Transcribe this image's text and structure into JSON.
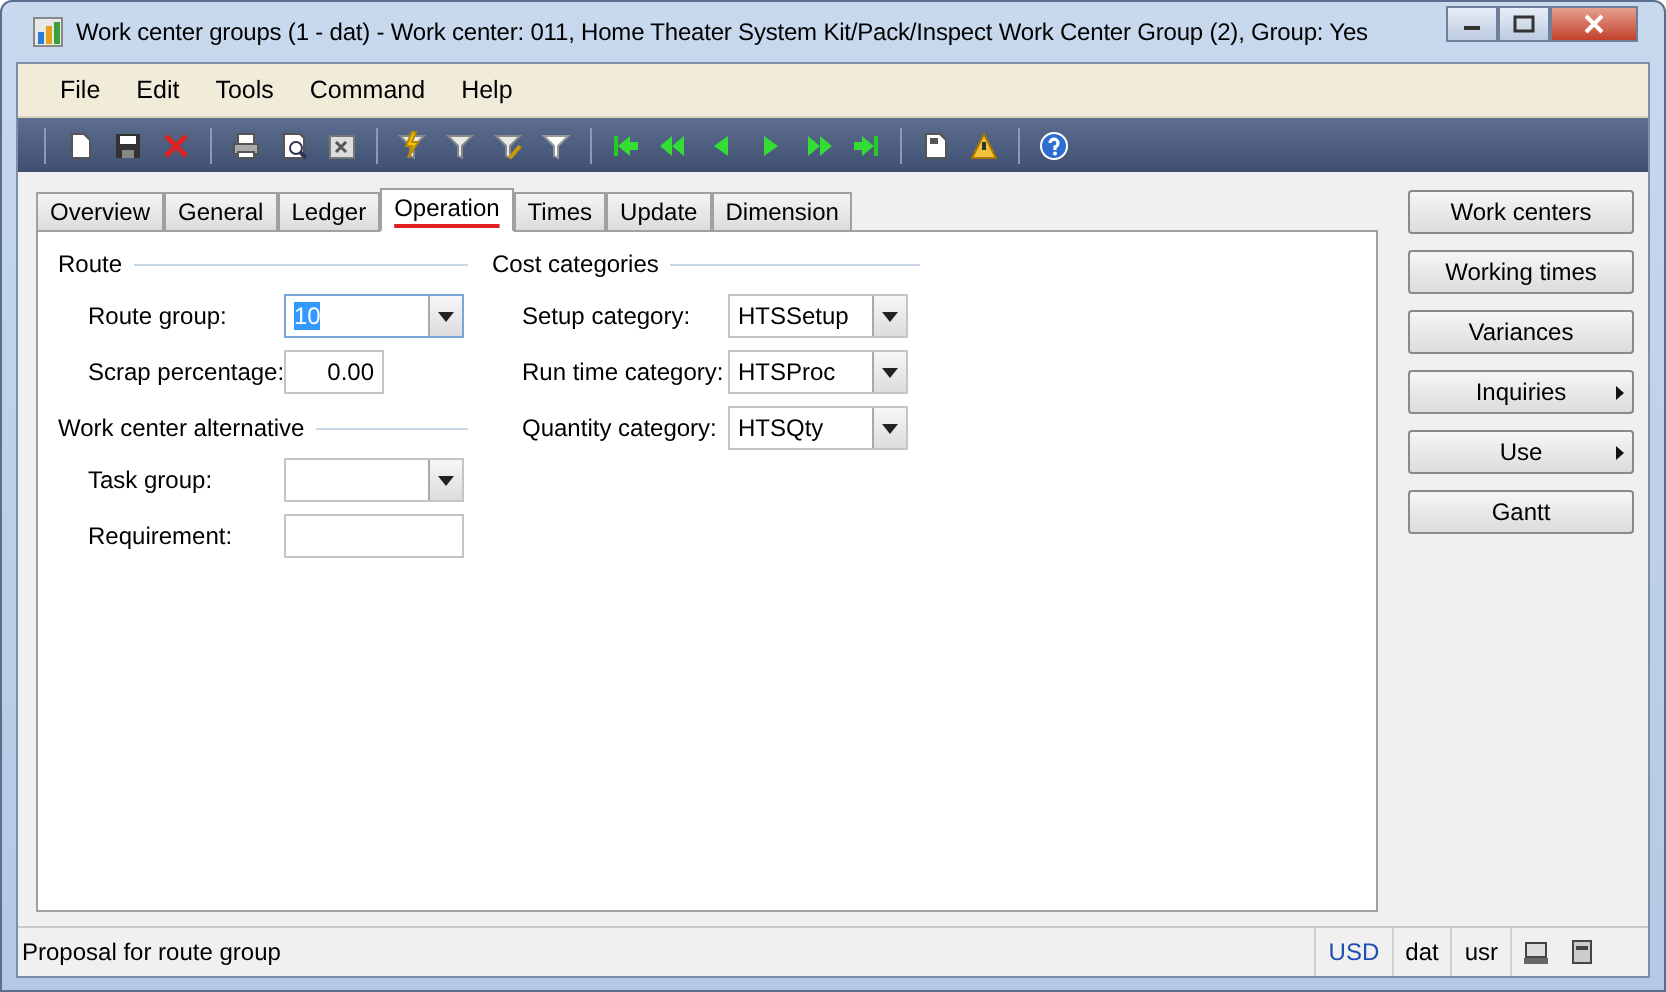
{
  "window": {
    "title": "Work center groups (1 - dat) - Work center: 011, Home Theater System Kit/Pack/Inspect Work Center Group (2), Group: Yes"
  },
  "menu": [
    "File",
    "Edit",
    "Tools",
    "Command",
    "Help"
  ],
  "tabs": [
    {
      "label": "Overview",
      "selected": false
    },
    {
      "label": "General",
      "selected": false
    },
    {
      "label": "Ledger",
      "selected": false
    },
    {
      "label": "Operation",
      "selected": true
    },
    {
      "label": "Times",
      "selected": false
    },
    {
      "label": "Update",
      "selected": false
    },
    {
      "label": "Dimension",
      "selected": false
    }
  ],
  "groups": [
    {
      "title": "Route",
      "fields": [
        {
          "label": "Route group:",
          "kind": "combo",
          "value": "10",
          "focused": true
        },
        {
          "label": "Scrap percentage:",
          "kind": "number",
          "value": "0.00",
          "focused": false
        }
      ]
    },
    {
      "title": "Work center alternative",
      "fields": [
        {
          "label": "Task group:",
          "kind": "combo",
          "focused": false
        },
        {
          "label": "Requirement:",
          "kind": "text",
          "focused": false
        }
      ]
    },
    {
      "title": "Cost categories",
      "fields": [
        {
          "label": "Setup category:",
          "kind": "combo",
          "value": "HTSSetup",
          "focused": false
        },
        {
          "label": "Run time category:",
          "kind": "combo",
          "value": "HTSProc",
          "focused": false
        },
        {
          "label": "Quantity category:",
          "kind": "combo",
          "value": "HTSQty",
          "focused": false
        }
      ]
    }
  ],
  "side_buttons": [
    {
      "label": "Work centers",
      "submenu": false
    },
    {
      "label": "Working times",
      "submenu": false
    },
    {
      "label": "Variances",
      "submenu": false
    },
    {
      "label": "Inquiries",
      "submenu": true
    },
    {
      "label": "Use",
      "submenu": true
    },
    {
      "label": "Gantt",
      "submenu": false
    }
  ],
  "status_bar": {
    "message": "Proposal for route group",
    "currency": "USD",
    "company": "dat",
    "user": "usr"
  }
}
